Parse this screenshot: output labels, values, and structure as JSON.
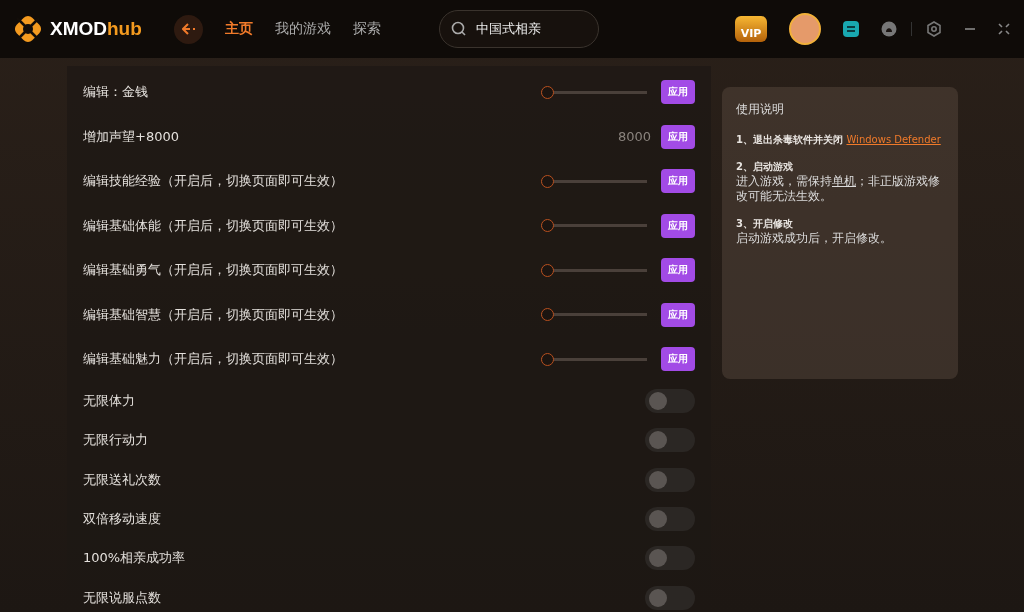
{
  "header": {
    "logo_text": "XMOD",
    "logo_accent": "hub",
    "nav": [
      {
        "label": "主页",
        "selected": true
      },
      {
        "label": "我的游戏",
        "selected": false
      },
      {
        "label": "探索",
        "selected": false
      }
    ],
    "search": {
      "value": "中国式相亲"
    },
    "vip": "VIP"
  },
  "options": [
    {
      "kind": "slider",
      "label": "编辑：金钱",
      "level": 0,
      "button": "应用"
    },
    {
      "kind": "value",
      "label": "增加声望+8000",
      "value": "8000",
      "button": "应用"
    },
    {
      "kind": "slider",
      "label": "编辑技能经验（开启后，切换页面即可生效）",
      "level": 0,
      "button": "应用"
    },
    {
      "kind": "slider",
      "label": "编辑基础体能（开启后，切换页面即可生效）",
      "level": 0,
      "button": "应用"
    },
    {
      "kind": "slider",
      "label": "编辑基础勇气（开启后，切换页面即可生效）",
      "level": 0,
      "button": "应用"
    },
    {
      "kind": "slider",
      "label": "编辑基础智慧（开启后，切换页面即可生效）",
      "level": 0,
      "button": "应用"
    },
    {
      "kind": "slider",
      "label": "编辑基础魅力（开启后，切换页面即可生效）",
      "level": 0,
      "button": "应用"
    },
    {
      "kind": "toggle",
      "label": "无限体力",
      "on": false
    },
    {
      "kind": "toggle",
      "label": "无限行动力",
      "on": false
    },
    {
      "kind": "toggle",
      "label": "无限送礼次数",
      "on": false
    },
    {
      "kind": "toggle",
      "label": "双倍移动速度",
      "on": false
    },
    {
      "kind": "toggle",
      "label": "100%相亲成功率",
      "on": false
    },
    {
      "kind": "toggle",
      "label": "无限说服点数",
      "on": false
    }
  ],
  "instructions": {
    "title": "使用说明",
    "steps": [
      {
        "heading": "1、退出杀毒软件并关闭",
        "link": "Windows Defender"
      },
      {
        "heading": "2、启动游戏",
        "body_before": "进入游戏，需保持",
        "body_link": "单机",
        "body_after": "；非正版游戏修改可能无法生效。"
      },
      {
        "heading": "3、开启修改",
        "body_before": "启动游戏成功后，开启修改。"
      }
    ]
  }
}
